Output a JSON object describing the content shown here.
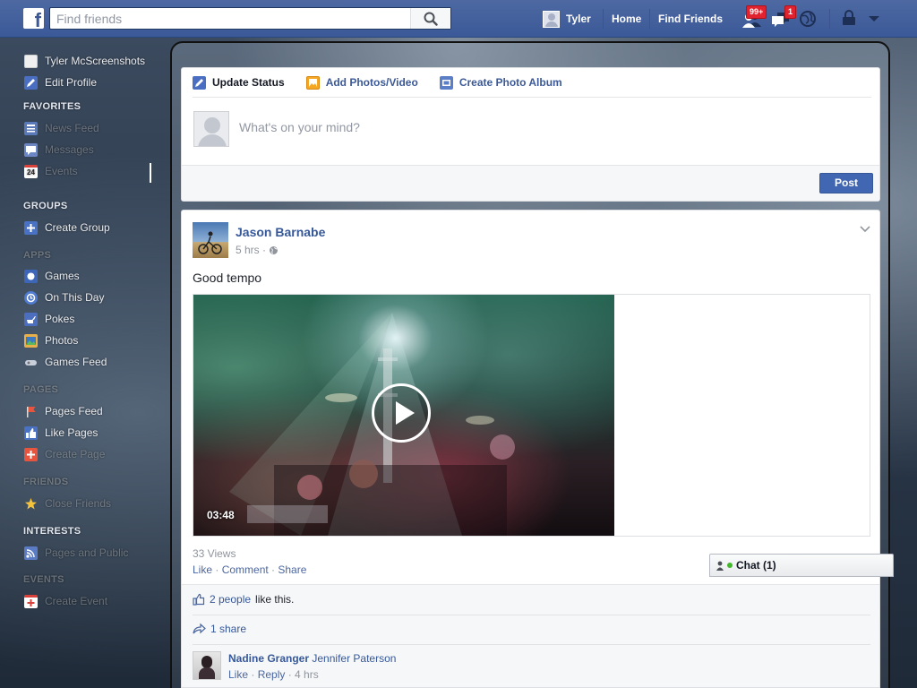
{
  "topbar": {
    "logo": "f",
    "search_placeholder": "Find friends",
    "user_name": "Tyler",
    "home": "Home",
    "find_friends": "Find Friends",
    "friend_requests_badge": "99+",
    "messages_badge": "1"
  },
  "sidebar": {
    "profile_name": "Tyler McScreenshots",
    "edit_profile": "Edit Profile",
    "favorites_heading": "FAVORITES",
    "favorites": [
      "News Feed",
      "Messages",
      "Events"
    ],
    "events_day": "24",
    "groups_heading": "GROUPS",
    "groups": [
      "Create Group"
    ],
    "apps_heading": "APPS",
    "apps": [
      "Games",
      "On This Day",
      "Pokes",
      "Photos",
      "Games Feed"
    ],
    "pages_heading": "PAGES",
    "pages": [
      "Pages Feed",
      "Like Pages",
      "Create Page"
    ],
    "friends_heading": "FRIENDS",
    "friends": [
      "Close Friends"
    ],
    "interests_heading": "INTERESTS",
    "interests": [
      "Pages and Public"
    ],
    "events_heading": "EVENTS",
    "events": [
      "Create Event"
    ]
  },
  "composer": {
    "tab_update_status": "Update Status",
    "tab_add_photos": "Add Photos/Video",
    "tab_create_album": "Create Photo Album",
    "placeholder": "What's on your mind?",
    "post_button": "Post"
  },
  "story": {
    "author": "Jason Barnabe",
    "time": "5 hrs ·",
    "text": "Good tempo",
    "video_duration": "03:48",
    "views": "33 Views",
    "actions": [
      "Like",
      "Comment",
      "Share"
    ],
    "likes_link": "2 people",
    "likes_suffix": "like this.",
    "shares": "1 share",
    "comment": {
      "author": "Nadine Granger",
      "tagged": "Jennifer Paterson",
      "actions": [
        "Like",
        "Reply"
      ],
      "time": "4 hrs"
    }
  },
  "chat": {
    "label": "Chat (1)"
  },
  "colors": {
    "brand_blue": "#3b5998",
    "link_blue": "#365899",
    "button_blue": "#4267b2",
    "badge_red": "#e0232e"
  }
}
